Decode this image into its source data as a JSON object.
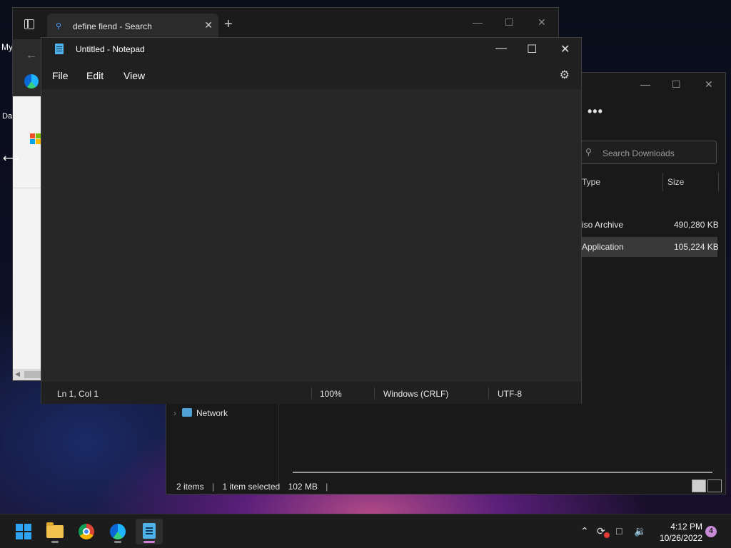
{
  "desktop": {
    "label_my": "My",
    "label_da": "Da"
  },
  "edge": {
    "tab_title": "define fiend - Search",
    "tab_close": "✕",
    "new_tab": "+",
    "minimize": "—",
    "maximize": "☐",
    "close": "✕",
    "back": "←"
  },
  "explorer": {
    "minimize": "—",
    "maximize": "☐",
    "close": "✕",
    "more": "•••",
    "search_placeholder": "Search Downloads",
    "columns": {
      "type": "Type",
      "size": "Size"
    },
    "rows": [
      {
        "type": "iso Archive",
        "size": "490,280 KB",
        "selected": false
      },
      {
        "type": "Application",
        "size": "105,224 KB",
        "selected": true
      }
    ],
    "nav_network": "Network",
    "status": {
      "items": "2 items",
      "selected": "1 item selected",
      "size": "102 MB"
    }
  },
  "notepad": {
    "title": "Untitled - Notepad",
    "minimize": "—",
    "maximize": "☐",
    "close": "✕",
    "menu": [
      "File",
      "Edit",
      "View"
    ],
    "status": {
      "position": "Ln 1, Col 1",
      "zoom": "100%",
      "line_ending": "Windows (CRLF)",
      "encoding": "UTF-8"
    }
  },
  "taskbar": {
    "apps": [
      "start",
      "file-explorer",
      "chrome",
      "edge",
      "notepad"
    ],
    "time": "4:12 PM",
    "date": "10/26/2022",
    "notifications": "4"
  },
  "colors": {
    "accent_blue": "#2fa4f4",
    "taskbar_active_indicator": "#d47dd6",
    "window_dark": "#202020"
  }
}
